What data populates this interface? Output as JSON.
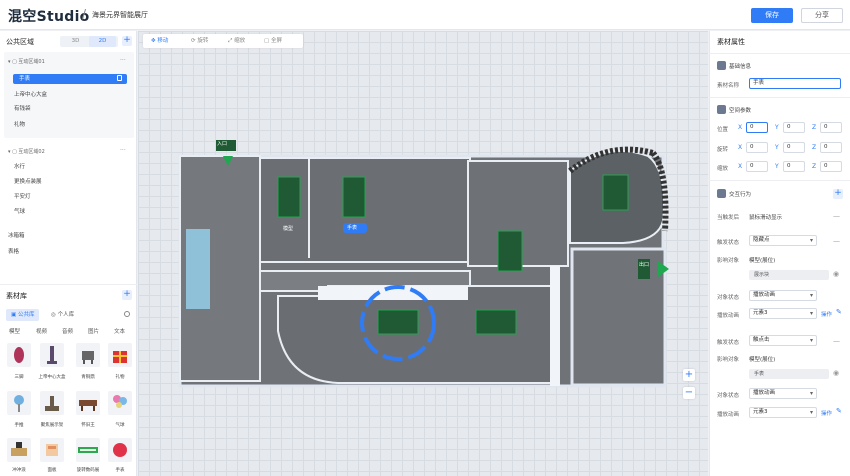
{
  "header": {
    "logo": "混空Studio",
    "separator": "/",
    "project": "海景元界智能展厅",
    "save_label": "保存",
    "share_label": "分享"
  },
  "left": {
    "public_area_title": "公共区域",
    "view_3d": "3D",
    "view_2d": "2D",
    "group1": "互动区域01",
    "group1_items": [
      "手表",
      "上帝中心大盒",
      "有钱袋",
      "礼物"
    ],
    "group2": "互动区域02",
    "group2_items": [
      "水行",
      "更换点装展",
      "平安灯",
      "气球"
    ],
    "loose_items": [
      "冰箱箱",
      "表格"
    ],
    "library_title": "素材库",
    "lib_tabs": [
      "公共库",
      "个人库"
    ],
    "categories": [
      "模型",
      "视频",
      "音频",
      "图片",
      "文本"
    ],
    "tiles_row1": [
      "三脚",
      "上帝中心大盒",
      "青铜鼎",
      "礼物"
    ],
    "tiles_row2": [
      "手推",
      "聚焦展示架",
      "怀旧王",
      "气球"
    ],
    "tiles_row3": [
      "冲冲浪",
      "面板",
      "旋转数码展",
      "手表"
    ]
  },
  "toolbar": {
    "move": "移动",
    "rotate": "旋转",
    "scale": "缩放",
    "fullscreen": "全屏"
  },
  "canvas": {
    "entrance_label": "入口",
    "mid_label": "模型",
    "badge": "手表",
    "exit_label": "出口"
  },
  "right": {
    "title": "素材属性",
    "basic": "基础信息",
    "name_label": "素材名称",
    "name_value": "手表",
    "spatial": "空间参数",
    "pos_label": "位置",
    "rot_label": "旋转",
    "scale_label": "缩放",
    "pos": [
      "0",
      "0",
      "0"
    ],
    "rot": [
      "0",
      "0",
      "0"
    ],
    "scl": [
      "0",
      "0",
      "0"
    ],
    "unit": "°",
    "interact": "交互行为",
    "trigger_label": "当触发后",
    "trigger_value": "鼠标滑动显示",
    "r1_label": "触发状态",
    "r1_value": "隐藏点",
    "r2_label": "影响对象",
    "r2_value": "模型(展位)",
    "chip1": "展示块",
    "r3_label": "对象状态",
    "r3_value": "播放动画",
    "r4_label": "播放动画",
    "r4_value": "元素3",
    "link_text": "操作",
    "r5_label": "触发状态",
    "r5_value": "触点击",
    "r6_label": "影响对象",
    "r6_value": "模型(展位)",
    "chip2": "手表",
    "r7_label": "对象状态",
    "r7_value": "播放动画",
    "r8_label": "播放动画",
    "r8_value": "元素3"
  },
  "colors": {
    "accent": "#2f7cf6",
    "floor": "#6f7378",
    "wall": "#eef2f7",
    "marker": "#1fa84f"
  }
}
